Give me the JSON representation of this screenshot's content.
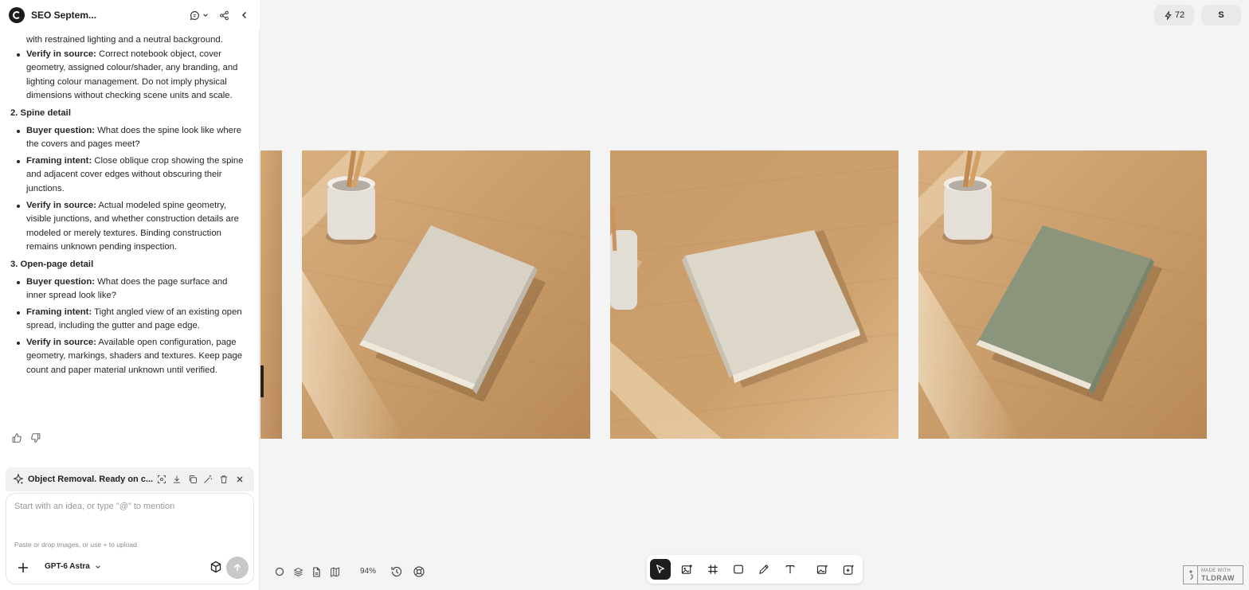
{
  "header": {
    "title": "SEO Septem...",
    "logo_icon": "app-logo-icon",
    "icons": [
      "chat-thread-icon",
      "chevron-down-icon",
      "share-icon",
      "collapse-panel-icon"
    ]
  },
  "chat": {
    "top_fragment": "with restrained lighting and a neutral background.",
    "intro_item": {
      "label": "Verify in source:",
      "text": "Correct notebook object, cover geometry, assigned colour/shader, any branding, and lighting colour management. Do not imply physical dimensions without checking scene units and scale."
    },
    "sections": [
      {
        "heading": "2. Spine detail",
        "items": [
          {
            "label": "Buyer question:",
            "text": "What does the spine look like where the covers and pages meet?"
          },
          {
            "label": "Framing intent:",
            "text": "Close oblique crop showing the spine and adjacent cover edges without obscuring their junctions."
          },
          {
            "label": "Verify in source:",
            "text": "Actual modeled spine geometry, visible junctions, and whether construction details are modeled or merely textures. Binding construction remains unknown pending inspection."
          }
        ]
      },
      {
        "heading": "3. Open-page detail",
        "items": [
          {
            "label": "Buyer question:",
            "text": "What does the page surface and inner spread look like?"
          },
          {
            "label": "Framing intent:",
            "text": "Tight angled view of an existing open spread, including the gutter and page edge."
          },
          {
            "label": "Verify in source:",
            "text": "Available open configuration, page geometry, markings, shaders and textures. Keep page count and paper material unknown until verified."
          }
        ]
      }
    ],
    "feedback_icons": [
      "thumbs-up-icon",
      "thumbs-down-icon"
    ]
  },
  "task": {
    "label": "Object Removal. Ready on c...",
    "icon": "sparkle-icon",
    "actions": [
      "focus-icon",
      "download-icon",
      "copy-icon",
      "magic-wand-icon",
      "trash-icon",
      "close-icon"
    ]
  },
  "composer": {
    "placeholder": "Start with an idea, or type \"@\" to mention",
    "hint": "Paste or drop images, or use + to upload",
    "model": "GPT-6 Astra"
  },
  "topbar_right": {
    "credits": "72",
    "user_initial": "S"
  },
  "canvas": {
    "zoom": "94%",
    "images": [
      {
        "name": "notebook-partial",
        "cover": "#dad4c7"
      },
      {
        "name": "notebook-cream-with-pencil-cup",
        "cover": "#d8d2c4"
      },
      {
        "name": "notebook-cream-closeup",
        "cover": "#ddd7c9"
      },
      {
        "name": "notebook-green-with-pencil-cup",
        "cover": "#8b957c"
      }
    ]
  },
  "toolbar": {
    "tools": [
      "select-tool-icon",
      "image-tool-icon",
      "frame-tool-icon",
      "rectangle-tool-icon",
      "pen-tool-icon",
      "text-tool-icon",
      "image-gen-tool-icon",
      "ai-tool-icon"
    ]
  },
  "watermark": {
    "made_with": "MADE WITH",
    "name": "TLDRAW"
  },
  "colors": {
    "accent_dark": "#1e1e1e",
    "panel_bg": "#ffffff",
    "canvas_bg": "#f4f4f4",
    "wood": "#c89a66"
  }
}
